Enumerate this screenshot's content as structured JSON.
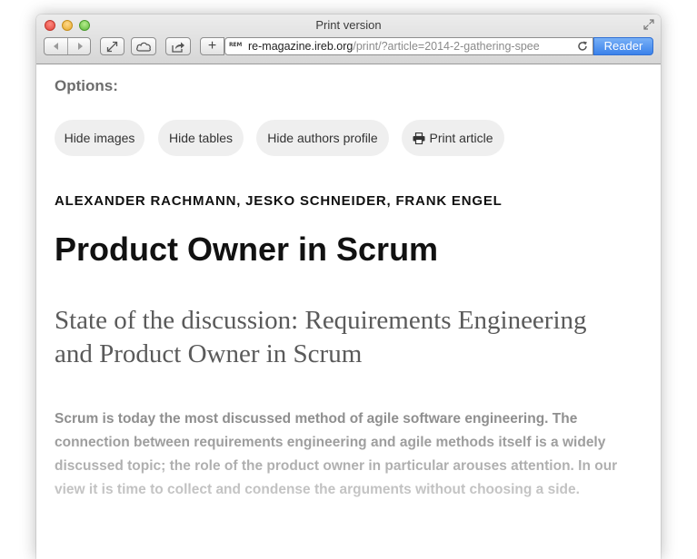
{
  "window": {
    "title": "Print version"
  },
  "toolbar": {
    "back_icon": "back-arrow-icon",
    "forward_icon": "forward-arrow-icon",
    "fullscreen_icon": "expand-arrows-icon",
    "icloud_icon": "cloud-icon",
    "share_icon": "share-icon",
    "new_tab_label": "+",
    "favicon_text": "REM",
    "url_host": "re-magazine.ireb.org",
    "url_path": "/print/?article=2014-2-gathering-spee",
    "reload_icon": "reload-icon",
    "reader_label": "Reader"
  },
  "page": {
    "options_label": "Options:",
    "buttons": {
      "hide_images": "Hide images",
      "hide_tables": "Hide tables",
      "hide_authors": "Hide authors profile",
      "print_article": "Print article"
    },
    "authors": "ALEXANDER RACHMANN, JESKO SCHNEIDER, FRANK ENGEL",
    "title": "Product Owner in Scrum",
    "subtitle": "State of the discussion: Requirements Engineering and Product Owner in Scrum",
    "abstract": "Scrum is today the most discussed method of agile software engineering. The connection between requirements engineering and agile methods itself is a widely discussed topic; the role of the product owner in particular arouses attention. In our view it is time to collect and condense the arguments without choosing a side."
  },
  "colors": {
    "reader_accent": "#3b82ea",
    "option_button_bg": "#efefef",
    "abstract_text": "#8f8f8f"
  }
}
